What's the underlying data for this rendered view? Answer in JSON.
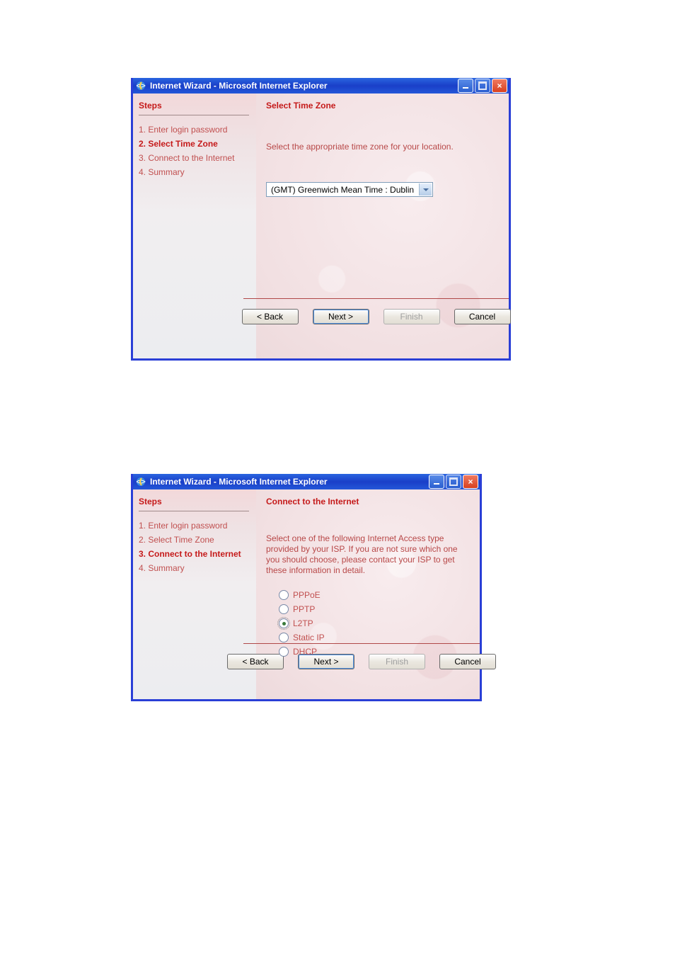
{
  "windows": [
    {
      "title": "Internet Wizard - Microsoft Internet Explorer",
      "sidebar_title": "Steps",
      "steps": [
        {
          "label": "1. Enter login password",
          "active": false
        },
        {
          "label": "2. Select Time Zone",
          "active": true
        },
        {
          "label": "3. Connect to the Internet",
          "active": false
        },
        {
          "label": "4. Summary",
          "active": false
        }
      ],
      "main_title": "Select Time Zone",
      "description": "Select the appropriate time zone for your location.",
      "timezone_value": "(GMT) Greenwich Mean Time : Dublin",
      "buttons": {
        "back": "< Back",
        "next": "Next >",
        "finish": "Finish",
        "cancel": "Cancel"
      }
    },
    {
      "title": "Internet Wizard - Microsoft Internet Explorer",
      "sidebar_title": "Steps",
      "steps": [
        {
          "label": "1. Enter login password",
          "active": false
        },
        {
          "label": "2. Select Time Zone",
          "active": false
        },
        {
          "label": "3. Connect to the Internet",
          "active": true
        },
        {
          "label": "4. Summary",
          "active": false
        }
      ],
      "main_title": "Connect to the Internet",
      "description": "Select one of the following Internet Access type provided by your ISP. If you are not sure which one you should choose, please contact your ISP to get these information in detail.",
      "radio_options": [
        {
          "label": "PPPoE",
          "selected": false
        },
        {
          "label": "PPTP",
          "selected": false
        },
        {
          "label": "L2TP",
          "selected": true
        },
        {
          "label": "Static IP",
          "selected": false
        },
        {
          "label": "DHCP",
          "selected": false
        }
      ],
      "buttons": {
        "back": "< Back",
        "next": "Next >",
        "finish": "Finish",
        "cancel": "Cancel"
      }
    }
  ]
}
